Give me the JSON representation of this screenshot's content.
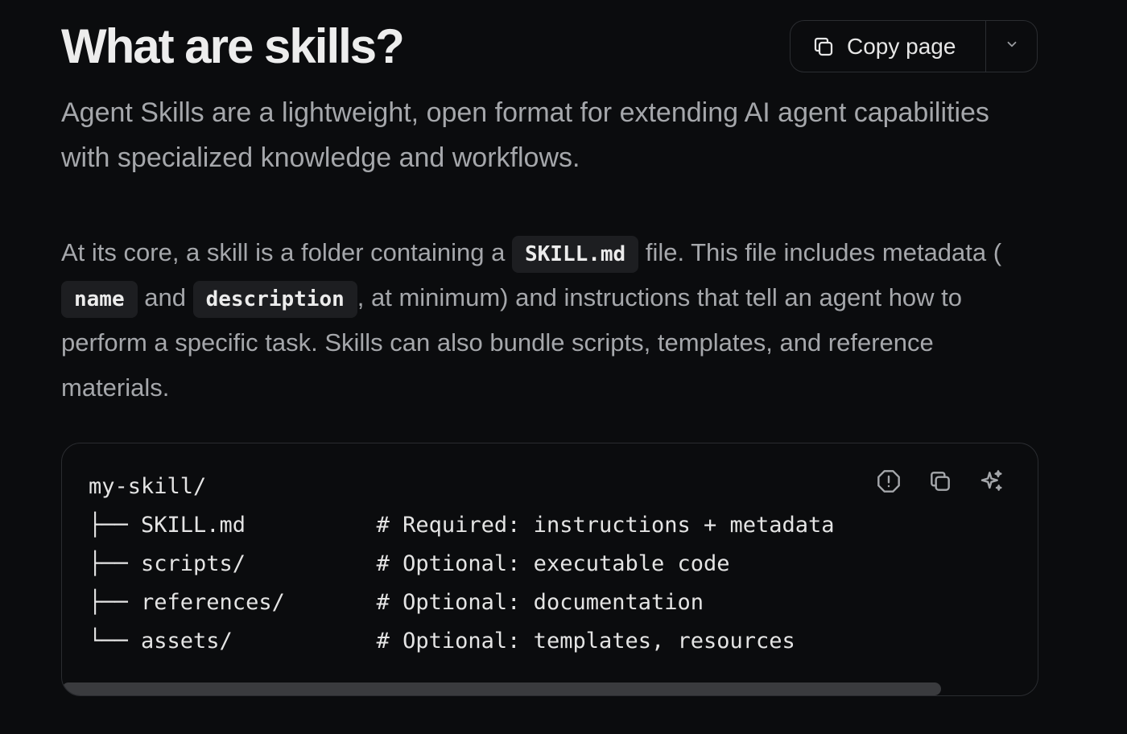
{
  "header": {
    "title": "What are skills?",
    "copy_button_label": "Copy page",
    "copy_icon": "copy-icon",
    "dropdown_icon": "chevron-down-icon"
  },
  "lead": "Agent Skills are a lightweight, open format for extending AI agent capabilities with specialized knowledge and workflows.",
  "body": {
    "part1": "At its core, a skill is a folder containing a ",
    "code1": "SKILL.md",
    "part2": " file. This file includes metadata (",
    "code2": "name",
    "part3": " and ",
    "code3": "description",
    "part4": ", at minimum) and instructions that tell an agent how to perform a specific task. Skills can also bundle scripts, templates, and reference materials."
  },
  "code_block": {
    "lines": [
      "my-skill/",
      "├── SKILL.md          # Required: instructions + metadata",
      "├── scripts/          # Optional: executable code",
      "├── references/       # Optional: documentation",
      "└── assets/           # Optional: templates, resources"
    ],
    "actions": [
      "report-issue-icon",
      "copy-icon",
      "ask-ai-sparkle-icon"
    ]
  },
  "colors": {
    "background": "#0b0c0e",
    "heading": "#ededed",
    "body_text": "#a5a7ab",
    "inline_code_bg": "#1d1e21",
    "border": "#2b2d31",
    "scrollbar": "#3a3b3e"
  }
}
